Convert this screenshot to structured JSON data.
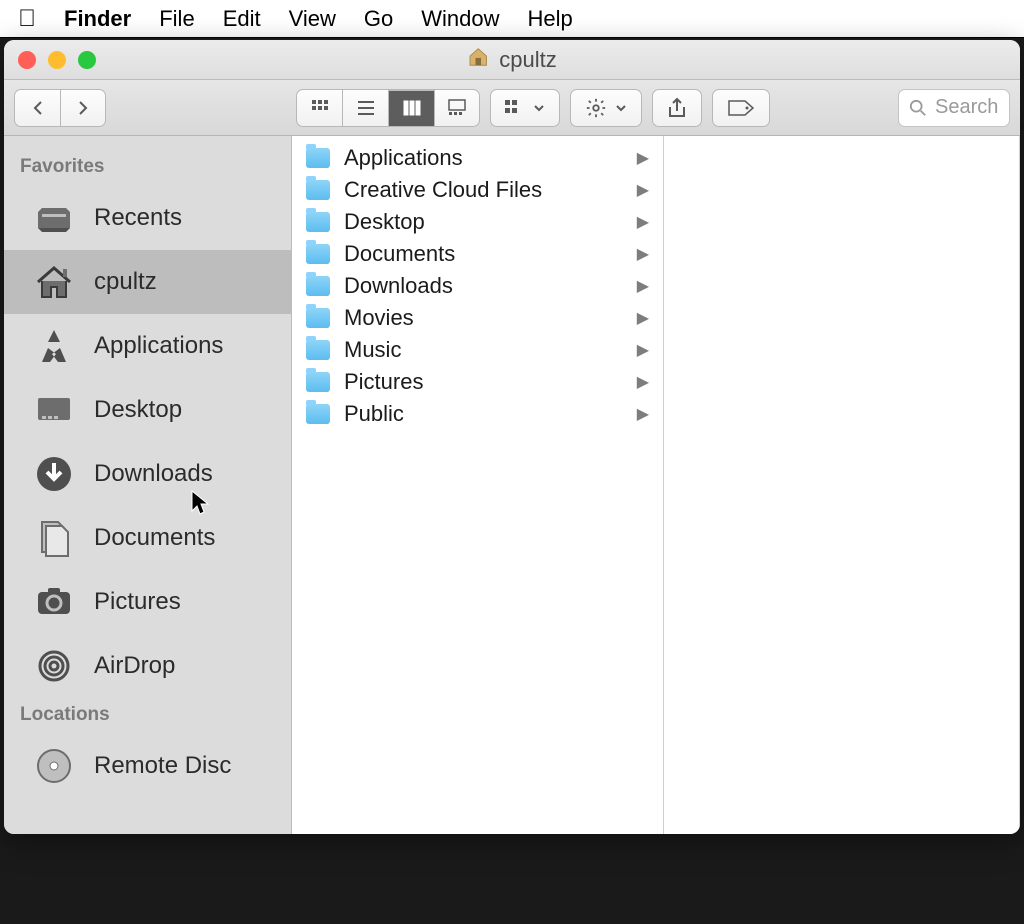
{
  "menubar": {
    "app": "Finder",
    "items": [
      "File",
      "Edit",
      "View",
      "Go",
      "Window",
      "Help"
    ]
  },
  "window": {
    "title": "cpultz"
  },
  "toolbar": {
    "search_placeholder": "Search"
  },
  "sidebar": {
    "sections": [
      {
        "title": "Favorites",
        "items": [
          {
            "icon": "recents",
            "label": "Recents",
            "selected": false
          },
          {
            "icon": "home",
            "label": "cpultz",
            "selected": true
          },
          {
            "icon": "apps",
            "label": "Applications",
            "selected": false
          },
          {
            "icon": "desktop",
            "label": "Desktop",
            "selected": false
          },
          {
            "icon": "downloads",
            "label": "Downloads",
            "selected": false
          },
          {
            "icon": "documents",
            "label": "Documents",
            "selected": false
          },
          {
            "icon": "pictures",
            "label": "Pictures",
            "selected": false
          },
          {
            "icon": "airdrop",
            "label": "AirDrop",
            "selected": false
          }
        ]
      },
      {
        "title": "Locations",
        "items": [
          {
            "icon": "disc",
            "label": "Remote Disc",
            "selected": false
          }
        ]
      }
    ]
  },
  "column": {
    "items": [
      {
        "label": "Applications"
      },
      {
        "label": "Creative Cloud Files"
      },
      {
        "label": "Desktop"
      },
      {
        "label": "Documents"
      },
      {
        "label": "Downloads"
      },
      {
        "label": "Movies"
      },
      {
        "label": "Music"
      },
      {
        "label": "Pictures"
      },
      {
        "label": "Public"
      }
    ]
  }
}
